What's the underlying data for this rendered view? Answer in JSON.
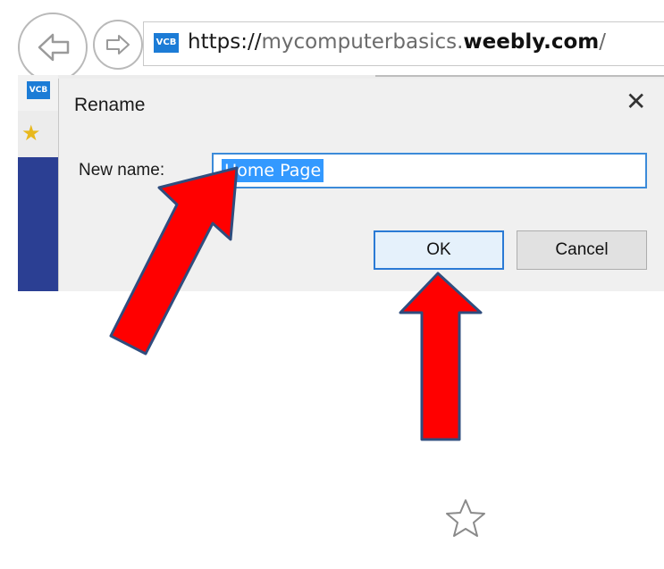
{
  "browser": {
    "back_icon": "back-arrow-icon",
    "forward_icon": "forward-arrow-icon",
    "favicon_text": "VCB",
    "url_prefix": "https://",
    "url_domain_pre": "mycomputerbasics.",
    "url_domain_bold": "weebly.com",
    "url_suffix": "/"
  },
  "tab": {
    "favicon_text": "VCB"
  },
  "dialog": {
    "title": "Rename",
    "close_glyph": "✕",
    "field_label": "New name:",
    "field_value": "Home Page",
    "ok_label": "OK",
    "cancel_label": "Cancel"
  },
  "colors": {
    "arrow_fill": "#ff0000",
    "arrow_stroke": "#2f4d7e",
    "selection": "#3399ff",
    "ok_border": "#2a7ad5"
  },
  "icons": {
    "favorites": "favorites-star-icon",
    "bottom_star": "star-outline-icon"
  }
}
